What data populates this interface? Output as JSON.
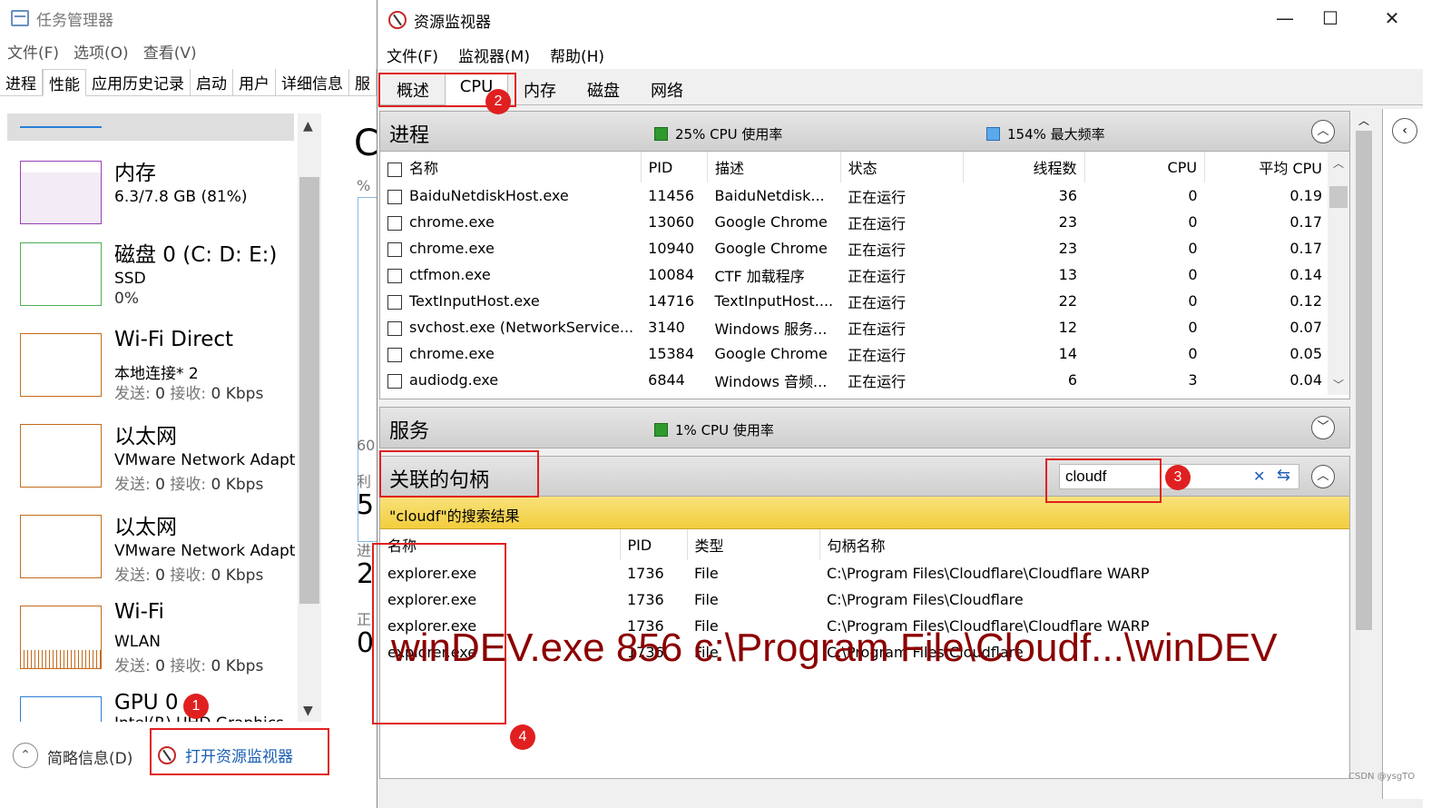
{
  "task_manager": {
    "title": "任务管理器",
    "menu": [
      "文件(F)",
      "选项(O)",
      "查看(V)"
    ],
    "tabs": [
      "进程",
      "性能",
      "应用历史记录",
      "启动",
      "用户",
      "详细信息",
      "服"
    ],
    "items": [
      {
        "label": "内存",
        "sub1": "6.3/7.8 GB (81%)",
        "sub2": "",
        "color": "#9b3fb5"
      },
      {
        "label": "磁盘 0 (C: D: E:)",
        "sub1": "SSD",
        "sub2": "0%",
        "color": "#4caf50"
      },
      {
        "label": "Wi-Fi Direct",
        "sub1": "本地连接* 2",
        "send": "0",
        "recv": "0 Kbps",
        "color": "#c46a1b"
      },
      {
        "label": "以太网",
        "sub1": "VMware Network Adapt",
        "send": "0",
        "recv": "0 Kbps",
        "color": "#c46a1b"
      },
      {
        "label": "以太网",
        "sub1": "VMware Network Adapt",
        "send": "0",
        "recv": "0 Kbps",
        "color": "#c46a1b"
      },
      {
        "label": "Wi-Fi",
        "sub1": "WLAN",
        "send": "0",
        "recv": "0 Kbps",
        "color": "#c46a1b"
      },
      {
        "label": "GPU 0",
        "sub1": "Intel(R) UHD Graphics",
        "color": "#2a7fd5"
      }
    ],
    "send_label": "发送:",
    "recv_label": "接收:",
    "right_fragments": {
      "big_c": "C",
      "pct": "%",
      "sixty": "60",
      "li": "利",
      "n5": "5",
      "jin": "进",
      "n2": "2",
      "zheng": "正",
      "n0": "0"
    },
    "footer": {
      "fewer_details": "简略信息(D)",
      "open_resmon": "打开资源监视器"
    }
  },
  "resource_monitor": {
    "title": "资源监视器",
    "window_controls": {
      "minimize": "—",
      "maximize": "☐",
      "close": "✕"
    },
    "menu": [
      "文件(F)",
      "监视器(M)",
      "帮助(H)"
    ],
    "tabs": [
      "概述",
      "CPU",
      "内存",
      "磁盘",
      "网络"
    ],
    "processes": {
      "title": "进程",
      "cpu_usage": "25% CPU 使用率",
      "max_freq": "154% 最大频率",
      "columns": [
        "名称",
        "PID",
        "描述",
        "状态",
        "线程数",
        "CPU",
        "平均 CPU"
      ],
      "rows": [
        [
          "BaiduNetdiskHost.exe",
          "11456",
          "BaiduNetdisk...",
          "正在运行",
          "36",
          "0",
          "0.19"
        ],
        [
          "chrome.exe",
          "13060",
          "Google Chrome",
          "正在运行",
          "23",
          "0",
          "0.17"
        ],
        [
          "chrome.exe",
          "10940",
          "Google Chrome",
          "正在运行",
          "23",
          "0",
          "0.17"
        ],
        [
          "ctfmon.exe",
          "10084",
          "CTF 加载程序",
          "正在运行",
          "13",
          "0",
          "0.14"
        ],
        [
          "TextInputHost.exe",
          "14716",
          "TextInputHost....",
          "正在运行",
          "22",
          "0",
          "0.12"
        ],
        [
          "svchost.exe (NetworkService...",
          "3140",
          "Windows 服务...",
          "正在运行",
          "12",
          "0",
          "0.07"
        ],
        [
          "chrome.exe",
          "15384",
          "Google Chrome",
          "正在运行",
          "14",
          "0",
          "0.05"
        ],
        [
          "audiodg.exe",
          "6844",
          "Windows 音频...",
          "正在运行",
          "6",
          "3",
          "0.04"
        ]
      ]
    },
    "services": {
      "title": "服务",
      "cpu_usage": "1% CPU 使用率"
    },
    "handles": {
      "title": "关联的句柄",
      "search_value": "cloudf",
      "search_result": "\"cloudf\"的搜索结果",
      "columns": [
        "名称",
        "PID",
        "类型",
        "句柄名称"
      ],
      "rows": [
        [
          "explorer.exe",
          "1736",
          "File",
          "C:\\Program Files\\Cloudflare\\Cloudflare WARP"
        ],
        [
          "explorer.exe",
          "1736",
          "File",
          "C:\\Program Files\\Cloudflare"
        ],
        [
          "explorer.exe",
          "1736",
          "File",
          "C:\\Program Files\\Cloudflare\\Cloudflare WARP"
        ],
        [
          "explorer.exe",
          "1736",
          "File",
          "C:\\Program Files\\Cloudflare"
        ]
      ],
      "annotation": "winDEV.exe    856     c:\\Program File\\Cloudf...\\winDEV"
    }
  },
  "annotations": {
    "badges": [
      "1",
      "2",
      "3",
      "4"
    ],
    "colors": {
      "red": "#e02020",
      "note": "#8b0000"
    }
  },
  "watermark": "CSDN @ysgTO"
}
